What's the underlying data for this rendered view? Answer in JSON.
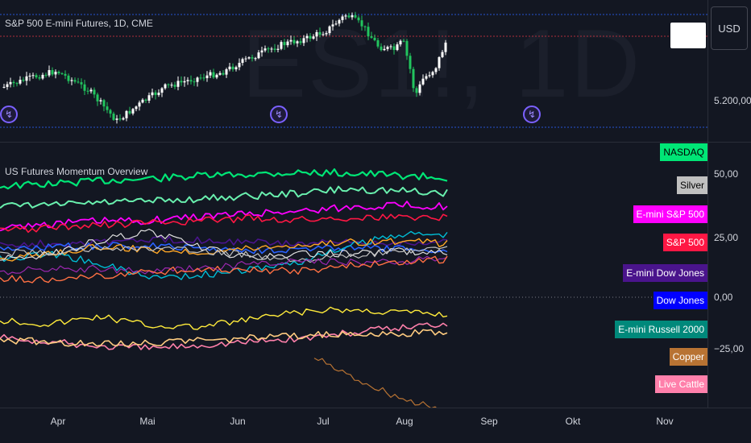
{
  "top_pane": {
    "title": "S&P 500 E-mini Futures, 1D, CME",
    "watermark": "ES1!, 1D",
    "currency_button": "USD",
    "price_label": "5.200,00",
    "event_marker": "↯"
  },
  "bottom_pane": {
    "title": "US Futures Momentum Overview",
    "axis_labels": [
      "50,00",
      "25,00",
      "0,00",
      "−25,00"
    ],
    "legend": [
      {
        "label": "NASDAQ",
        "bg": "#00e676",
        "fg": "#000000"
      },
      {
        "label": "Silver",
        "bg": "#c0c0c0",
        "fg": "#000000"
      },
      {
        "label": "E-mini S&P 500",
        "bg": "#ff00ff",
        "fg": "#ffffff"
      },
      {
        "label": "S&P 500",
        "bg": "#ff1744",
        "fg": "#ffffff"
      },
      {
        "label": "E-mini Dow Jones",
        "bg": "#4a148c",
        "fg": "#ffffff"
      },
      {
        "label": "Dow Jones",
        "bg": "#0000ff",
        "fg": "#ffffff"
      },
      {
        "label": "E-mini Russell 2000",
        "bg": "#00897b",
        "fg": "#ffffff"
      },
      {
        "label": "Copper",
        "bg": "#b87333",
        "fg": "#ffffff"
      },
      {
        "label": "Live Cattle",
        "bg": "#ff80ab",
        "fg": "#ffffff"
      }
    ]
  },
  "time_axis": {
    "months": [
      "Apr",
      "Mai",
      "Jun",
      "Jul",
      "Aug",
      "Sep",
      "Okt",
      "Nov"
    ]
  },
  "colors": {
    "background": "#131722",
    "grid": "#2a2e39",
    "candle_up": "#ffffff",
    "candle_down": "#22c55e",
    "hline_blue": "#2962ff",
    "hline_red": "#f23645",
    "accent_event": "#7b61ff"
  }
}
